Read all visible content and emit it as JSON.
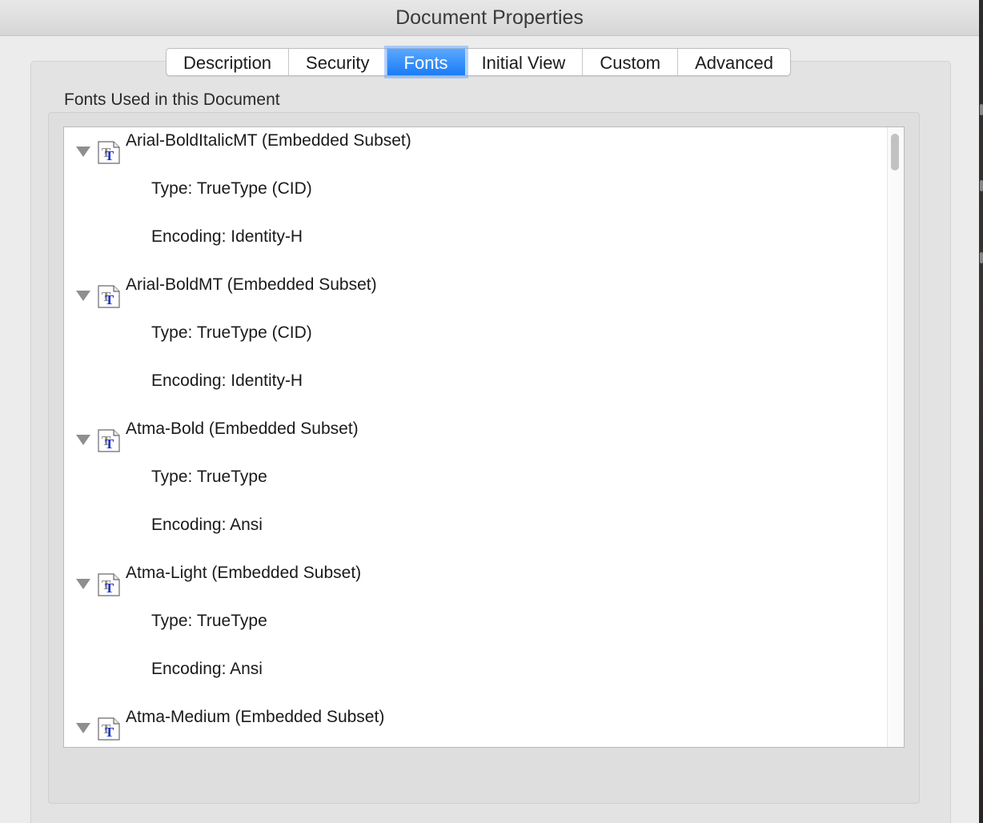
{
  "window": {
    "title": "Document Properties"
  },
  "tabs": [
    {
      "label": "Description",
      "active": false
    },
    {
      "label": "Security",
      "active": false
    },
    {
      "label": "Fonts",
      "active": true
    },
    {
      "label": "Initial View",
      "active": false
    },
    {
      "label": "Custom",
      "active": false
    },
    {
      "label": "Advanced",
      "active": false
    }
  ],
  "fonts_section": {
    "label": "Fonts Used in this Document",
    "fonts": [
      {
        "name": "Arial-BoldItalicMT (Embedded Subset)",
        "type": "Type: TrueType (CID)",
        "encoding": "Encoding: Identity-H",
        "icon": "truetype-font-icon"
      },
      {
        "name": "Arial-BoldMT (Embedded Subset)",
        "type": "Type: TrueType (CID)",
        "encoding": "Encoding: Identity-H",
        "icon": "truetype-font-icon"
      },
      {
        "name": "Atma-Bold (Embedded Subset)",
        "type": "Type: TrueType",
        "encoding": "Encoding: Ansi",
        "icon": "truetype-font-icon"
      },
      {
        "name": "Atma-Light (Embedded Subset)",
        "type": "Type: TrueType",
        "encoding": "Encoding: Ansi",
        "icon": "truetype-font-icon"
      },
      {
        "name": "Atma-Medium (Embedded Subset)",
        "icon": "truetype-font-icon"
      }
    ]
  },
  "colors": {
    "active_tab": "#1a7cf5",
    "window_bg": "#ececec",
    "list_bg": "#ffffff"
  }
}
